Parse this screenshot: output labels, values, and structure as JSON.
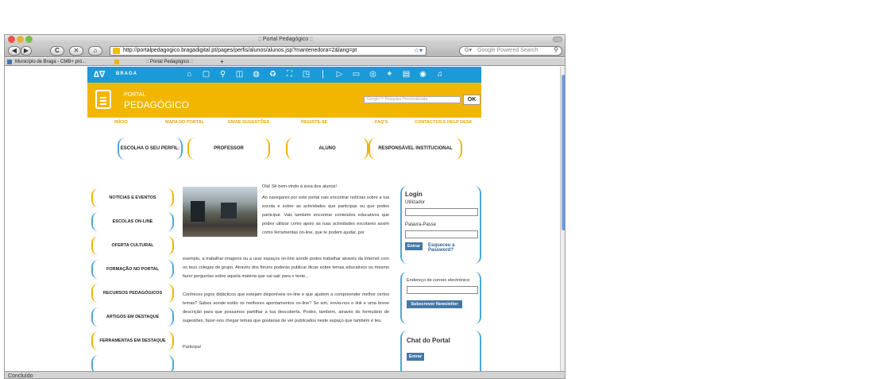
{
  "window": {
    "title": ":: Portal Pedagógico ::"
  },
  "toolbar": {
    "back_label": "◀",
    "forward_label": "▶",
    "reload_label": "C",
    "stop_label": "✕",
    "home_label": "⌂",
    "url": "http://portalpedagogico.bragadigital.pt/pages/perfis/alunos/alunos.jsp?mantenedora=2&lang=pt",
    "bookmark_star": "☆▾",
    "search_placeholder": "Google Powered Search"
  },
  "bookmarks": [
    {
      "label": "Município de Braga - CMB+ pró..."
    },
    {
      "label": ":: Portal Pedagógico ::"
    }
  ],
  "status": {
    "text": "Concluído"
  },
  "site": {
    "logo_text": "BRAGA",
    "nav_icons": [
      "⌂",
      "▢",
      "⚲",
      "◫",
      "◍",
      "♻",
      "⛶",
      "◳",
      "❘",
      "▷",
      "▭",
      "◎",
      "✦",
      "▤",
      "◉",
      "♫"
    ],
    "portal_line1": "PORTAL",
    "portal_line2": "PEDAGÓGICO",
    "google_placeholder": "Google™ Pesquisa Personalizada",
    "ok_label": "OK",
    "menu": [
      "INÍCIO",
      "MAPA DO PORTAL",
      "ENVIE SUGESTÕES",
      "REGISTE-SE",
      "FAQ'S",
      "CONTACTOS E HELP DESK"
    ],
    "profile_prompt": "ESCOLHA O SEU PERFIL:",
    "profiles": [
      "PROFESSOR",
      "ALUNO",
      "RESPONSÁVEL INSTITUCIONAL"
    ],
    "left_menu": [
      "NOTÍCIAS E EVENTOS",
      "ESCOLAS ON-LINE",
      "OFERTA CULTURAL",
      "FORMAÇÃO NO PORTAL",
      "RECURSOS PEDAGÓGICOS",
      "ARTIGOS EM DESTAQUE",
      "FERRAMENTAS EM DESTAQUE"
    ],
    "article": {
      "greeting": "Olá! Sê bem-vindo à área dos alunos!",
      "p1_side": "Ao navegares por este portal vais encontrar notícias sobre a tua escola e sobre as actividades que participas ou que podes participar. Vais também encontrar conteúdos educativos que podes utilizar como apoio às tuas actividades escolares assim como ferramentas on-line, que te podem ajudar, por",
      "p1_full": "exemplo, a trabalhar imagens ou a usar espaços on-line aonde podes trabalhar através da Internet com os teus colegas de grupo. Através dos fóruns poderás publicar dicas sobre temas educativos ou mesmo fazer perguntas sobre aquela matéria que vai sair para o teste...",
      "p2": "Conheces jogos didácticos que estejam disponíveis on-line e que ajudem a compreender melhor certos temas? Sabes aonde estão os melhores apontamentos on-line? Se sim, envia-nos o link e uma breve descrição para que possamos partilhar a tua descoberta. Podes, também, através do formulário de sugestões, fazer-nos chegar temas que gostarias de ver publicados neste espaço que também é teu.",
      "p3": "Participa!"
    },
    "login": {
      "title": "Login",
      "user_label": "Utilizador",
      "pass_label": "Palavra-Passe",
      "enter_label": "Entrar",
      "forgot_label": "Esqueceu a Password?"
    },
    "newsletter": {
      "label": "Endereço de correio electrónico:",
      "button": "Subscrever Newsletter"
    },
    "chat": {
      "title": "Chat do Portal",
      "enter_label": "Entrar"
    }
  },
  "colors": {
    "nav_blue": "#1a9ad6",
    "banner_gold": "#f2b600",
    "menu_gold": "#e7a400",
    "frame_blue": "#4aa8d6",
    "button_blue": "#4478a6"
  }
}
